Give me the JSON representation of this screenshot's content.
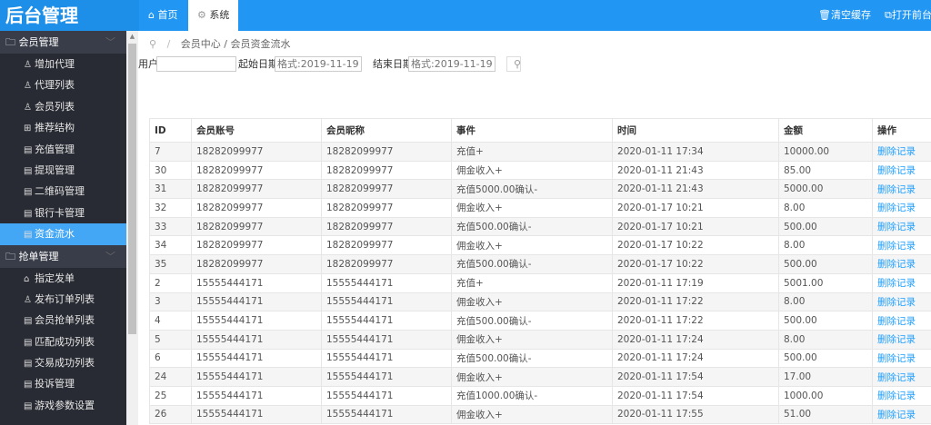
{
  "header": {
    "logo": "后台管理",
    "tabs": [
      {
        "label": "首页",
        "icon": "home-icon"
      },
      {
        "label": "系统",
        "icon": "gear-icon"
      }
    ],
    "clear_cache": "清空缓存",
    "open_front": "打开前台"
  },
  "sidebar": {
    "groups": [
      {
        "label": "会员管理",
        "items": [
          {
            "label": "增加代理",
            "icon": "user-icon"
          },
          {
            "label": "代理列表",
            "icon": "user-icon"
          },
          {
            "label": "会员列表",
            "icon": "user-icon"
          },
          {
            "label": "推荐结构",
            "icon": "grid-icon"
          },
          {
            "label": "充值管理",
            "icon": "file-icon"
          },
          {
            "label": "提现管理",
            "icon": "file-icon"
          },
          {
            "label": "二维码管理",
            "icon": "file-icon"
          },
          {
            "label": "银行卡管理",
            "icon": "file-icon"
          },
          {
            "label": "资金流水",
            "icon": "file-icon",
            "active": true
          }
        ]
      },
      {
        "label": "抢单管理",
        "items": [
          {
            "label": "指定发单",
            "icon": "lock-icon"
          },
          {
            "label": "发布订单列表",
            "icon": "user-icon"
          },
          {
            "label": "会员抢单列表",
            "icon": "file-icon"
          },
          {
            "label": "匹配成功列表",
            "icon": "file-icon"
          },
          {
            "label": "交易成功列表",
            "icon": "file-icon"
          },
          {
            "label": "投诉管理",
            "icon": "file-icon"
          },
          {
            "label": "游戏参数设置",
            "icon": "file-icon"
          }
        ]
      }
    ]
  },
  "breadcrumb": {
    "sep": "/",
    "path": "会员中心 / 会员资金流水"
  },
  "filter": {
    "user_label": "用户",
    "user_value": "",
    "start_label": "起始日期",
    "start_placeholder": "格式:2019-11-19",
    "end_label": "结束日期",
    "end_placeholder": "格式:2019-11-19"
  },
  "table": {
    "headers": [
      "ID",
      "会员账号",
      "会员昵称",
      "事件",
      "时间",
      "金额",
      "操作"
    ],
    "rows": [
      [
        "7",
        "18282099977",
        "18282099977",
        "充值+",
        "2020-01-11 17:34",
        "10000.00",
        "删除记录"
      ],
      [
        "30",
        "18282099977",
        "18282099977",
        "佣金收入+",
        "2020-01-11 21:43",
        "85.00",
        "删除记录"
      ],
      [
        "31",
        "18282099977",
        "18282099977",
        "充值5000.00确认-",
        "2020-01-11 21:43",
        "5000.00",
        "删除记录"
      ],
      [
        "32",
        "18282099977",
        "18282099977",
        "佣金收入+",
        "2020-01-17 10:21",
        "8.00",
        "删除记录"
      ],
      [
        "33",
        "18282099977",
        "18282099977",
        "充值500.00确认-",
        "2020-01-17 10:21",
        "500.00",
        "删除记录"
      ],
      [
        "34",
        "18282099977",
        "18282099977",
        "佣金收入+",
        "2020-01-17 10:22",
        "8.00",
        "删除记录"
      ],
      [
        "35",
        "18282099977",
        "18282099977",
        "充值500.00确认-",
        "2020-01-17 10:22",
        "500.00",
        "删除记录"
      ],
      [
        "2",
        "15555444171",
        "15555444171",
        "充值+",
        "2020-01-11 17:19",
        "5001.00",
        "删除记录"
      ],
      [
        "3",
        "15555444171",
        "15555444171",
        "佣金收入+",
        "2020-01-11 17:22",
        "8.00",
        "删除记录"
      ],
      [
        "4",
        "15555444171",
        "15555444171",
        "充值500.00确认-",
        "2020-01-11 17:22",
        "500.00",
        "删除记录"
      ],
      [
        "5",
        "15555444171",
        "15555444171",
        "佣金收入+",
        "2020-01-11 17:24",
        "8.00",
        "删除记录"
      ],
      [
        "6",
        "15555444171",
        "15555444171",
        "充值500.00确认-",
        "2020-01-11 17:24",
        "500.00",
        "删除记录"
      ],
      [
        "24",
        "15555444171",
        "15555444171",
        "佣金收入+",
        "2020-01-11 17:54",
        "17.00",
        "删除记录"
      ],
      [
        "25",
        "15555444171",
        "15555444171",
        "充值1000.00确认-",
        "2020-01-11 17:54",
        "1000.00",
        "删除记录"
      ],
      [
        "26",
        "15555444171",
        "15555444171",
        "佣金收入+",
        "2020-01-11 17:55",
        "51.00",
        "删除记录"
      ]
    ]
  }
}
